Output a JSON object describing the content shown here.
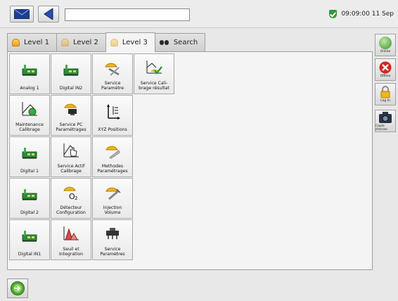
{
  "topbar": {
    "address_value": "",
    "clock": "09:09:00 11 Sep",
    "status_color": "#2f9a36"
  },
  "tabs": [
    {
      "label": "Level 1",
      "icon": "person-icon"
    },
    {
      "label": "Level 2",
      "icon": "person-icon"
    },
    {
      "label": "Level 3",
      "icon": "person-icon",
      "active": true
    },
    {
      "label": "Search",
      "icon": "binoculars-icon"
    }
  ],
  "tiles": [
    {
      "label": "Analog 1",
      "icon": "circuit-board-icon"
    },
    {
      "label": "Digital IN2",
      "icon": "circuit-board-icon"
    },
    {
      "label": "Service\nParamètre",
      "icon": "service-tools-icon"
    },
    {
      "label": "Service Cali-\nbrage résultat",
      "icon": "calibration-check-icon"
    },
    {
      "label": "Maintenance\nCalibrage",
      "icon": "calibration-maintenance-icon"
    },
    {
      "label": "Service PC\nParamétrages",
      "icon": "service-pc-icon"
    },
    {
      "label": "XYZ Positions",
      "icon": "xyz-axes-icon"
    },
    {
      "label": "",
      "icon": ""
    },
    {
      "label": "Digital 1",
      "icon": "circuit-board-icon"
    },
    {
      "label": "Service Actif\nCalibrage",
      "icon": "calibration-hand-icon"
    },
    {
      "label": "Methodes\nParamétrages",
      "icon": "methods-icon"
    },
    {
      "label": "",
      "icon": ""
    },
    {
      "label": "Digital 2",
      "icon": "circuit-board-icon"
    },
    {
      "label": "Détecteur\nConfiguration",
      "icon": "detector-o2-icon"
    },
    {
      "label": "Injection\nVolume",
      "icon": "injection-icon"
    },
    {
      "label": "",
      "icon": ""
    },
    {
      "label": "Digital IN1",
      "icon": "circuit-board-icon"
    },
    {
      "label": "Seuil et\nIntegration",
      "icon": "integration-chart-icon"
    },
    {
      "label": "Service\nParamètres",
      "icon": "service-params-icon"
    },
    {
      "label": "",
      "icon": ""
    }
  ],
  "sidebar": {
    "online": "Online",
    "offline": "Offline",
    "login": "Log In",
    "screenshot": "Copie d'ecran"
  }
}
